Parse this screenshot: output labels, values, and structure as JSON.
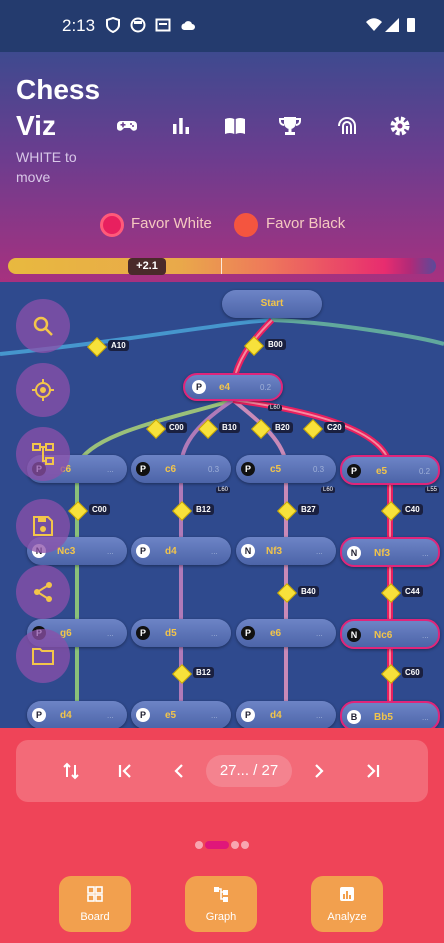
{
  "status_bar": {
    "time": "2:13"
  },
  "header": {
    "title_line1": "Chess",
    "title_line2": "Viz",
    "subtitle": "WHITE to move",
    "toolbar_icons": [
      "gamepad-icon",
      "bar-chart-icon",
      "book-icon",
      "trophy-icon",
      "fingerprint-icon",
      "settings-icon"
    ]
  },
  "legend": {
    "favor_white": "Favor White",
    "favor_black": "Favor Black"
  },
  "eval": {
    "label": "+2.1"
  },
  "graph": {
    "start": "Start",
    "eco": {
      "a10": "A10",
      "b00": "B00",
      "c00_top": "C00",
      "b10": "B10",
      "b20": "B20",
      "c20": "C20",
      "c00": "C00",
      "b12": "B12",
      "b27": "B27",
      "c40": "C40",
      "b40": "B40",
      "c44": "C44",
      "b12_low": "B12",
      "c60": "C60"
    },
    "nodes": {
      "e4": {
        "piece": "P",
        "move": "e4",
        "score": "0.2"
      },
      "c6a": {
        "piece": "P",
        "move": "c6",
        "score": "..."
      },
      "c6b": {
        "piece": "P",
        "move": "c6",
        "score": "0.3"
      },
      "c5": {
        "piece": "P",
        "move": "c5",
        "score": "0.3"
      },
      "e5": {
        "piece": "P",
        "move": "e5",
        "score": "0.2"
      },
      "nc3": {
        "piece": "N",
        "move": "Nc3",
        "score": "..."
      },
      "d4a": {
        "piece": "P",
        "move": "d4",
        "score": "..."
      },
      "nf3a": {
        "piece": "N",
        "move": "Nf3",
        "score": "..."
      },
      "nf3b": {
        "piece": "N",
        "move": "Nf3",
        "score": "..."
      },
      "g6": {
        "piece": "P",
        "move": "g6",
        "score": "..."
      },
      "d5": {
        "piece": "P",
        "move": "d5",
        "score": "..."
      },
      "e6": {
        "piece": "P",
        "move": "e6",
        "score": "..."
      },
      "nc6": {
        "piece": "N",
        "move": "Nc6",
        "score": "..."
      },
      "d4b": {
        "piece": "P",
        "move": "d4",
        "score": "..."
      },
      "e5b": {
        "piece": "P",
        "move": "e5",
        "score": "..."
      },
      "d4c": {
        "piece": "P",
        "move": "d4",
        "score": "..."
      },
      "bb5": {
        "piece": "B",
        "move": "Bb5",
        "score": "..."
      }
    },
    "badges": {
      "e4": "L60",
      "c6b": "L60",
      "c5": "L60",
      "e5": "L55"
    }
  },
  "nav": {
    "page": "27... / 27"
  },
  "tabs": {
    "board": "Board",
    "graph": "Graph",
    "analyze": "Analyze"
  },
  "colors": {
    "favor_white": "#e8205f",
    "favor_black": "#f4553f"
  }
}
